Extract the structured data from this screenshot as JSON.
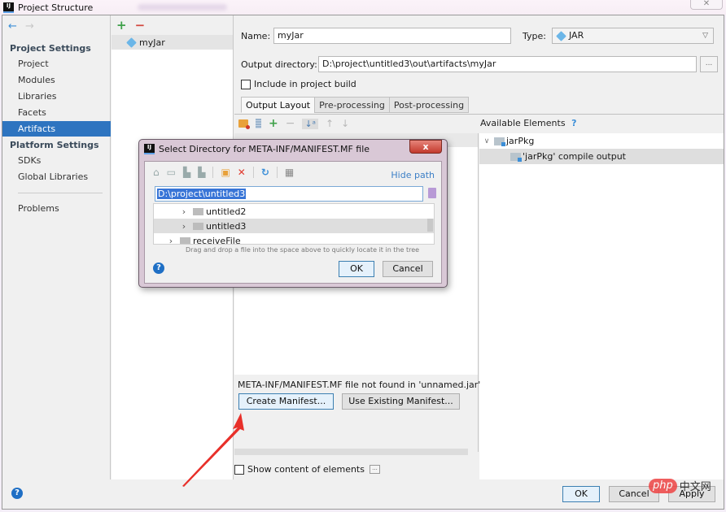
{
  "window": {
    "title": "Project Structure",
    "close_label": "✕"
  },
  "left_nav": {
    "back_icon": "←",
    "forward_icon": "→",
    "sections": [
      {
        "title": "Project Settings",
        "items": [
          "Project",
          "Modules",
          "Libraries",
          "Facets",
          "Artifacts"
        ]
      },
      {
        "title": "Platform Settings",
        "items": [
          "SDKs",
          "Global Libraries"
        ]
      }
    ],
    "selected_item": "Artifacts",
    "problems_label": "Problems"
  },
  "artifacts": {
    "add_icon": "+",
    "remove_icon": "−",
    "items": [
      {
        "name": "myJar"
      }
    ]
  },
  "artifact_form": {
    "name_label": "Name:",
    "name_value": "myJar",
    "type_label": "Type:",
    "type_value": "JAR",
    "output_dir_label": "Output directory:",
    "output_dir_value": "D:\\project\\untitled3\\out\\artifacts\\myJar",
    "browse_label": "...",
    "include_in_build_label": "Include in project build",
    "include_in_build_checked": false,
    "tabs": [
      "Output Layout",
      "Pre-processing",
      "Post-processing"
    ],
    "active_tab": "Output Layout"
  },
  "output_layout": {
    "available_elements_label": "Available Elements",
    "help_mark": "?",
    "available_tree": [
      {
        "label": "jarPkg",
        "expanded": true,
        "level": 0
      },
      {
        "label": "'jarPkg' compile output",
        "level": 1,
        "selected": true
      }
    ],
    "manifest_message": "META-INF/MANIFEST.MF file not found in 'unnamed.jar'",
    "create_manifest_label": "Create Manifest...",
    "use_existing_manifest_label": "Use Existing Manifest...",
    "show_content_label": "Show content of elements",
    "show_content_checked": false,
    "show_content_more": "..."
  },
  "footer": {
    "help": "?",
    "ok_label": "OK",
    "cancel_label": "Cancel",
    "apply_label": "Apply"
  },
  "dialog": {
    "title": "Select Directory for META-INF/MANIFEST.MF file",
    "close_label": "x",
    "hide_path_label": "Hide path",
    "path_value": "D:\\project\\untitled3",
    "tree": [
      {
        "label": "untitled2",
        "level": 1,
        "selected": false
      },
      {
        "label": "untitled3",
        "level": 1,
        "selected": true
      },
      {
        "label": "receiveFile",
        "level": 0,
        "selected": false
      }
    ],
    "hint": "Drag and drop a file into the space above to quickly locate it in the tree",
    "help": "?",
    "ok_label": "OK",
    "cancel_label": "Cancel"
  },
  "watermark": {
    "pill": "php",
    "text": "中文网"
  },
  "colors": {
    "selection_blue": "#2e74c0",
    "annotation_arrow": "#e8302a",
    "link_blue": "#3c7fc6"
  }
}
